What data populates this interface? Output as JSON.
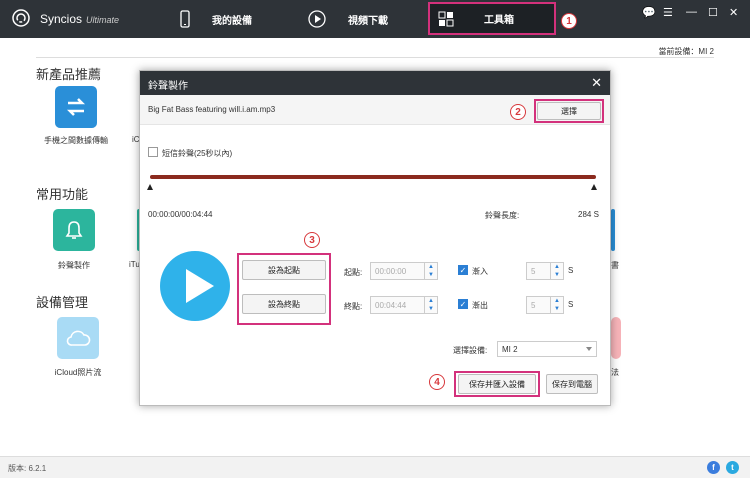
{
  "app": {
    "name": "Syncios",
    "edition": "Ultimate"
  },
  "nav": {
    "device": "我的設備",
    "video": "視頻下載",
    "toolbox": "工具箱"
  },
  "window_controls": [
    "💬",
    "☰",
    "—",
    "☐",
    "✕"
  ],
  "current_device": "當前設備：MI 2",
  "sections": {
    "new_products": {
      "title": "新產品推薦",
      "items": [
        {
          "label": "手機之間數據傳輸"
        },
        {
          "label": "iC"
        }
      ]
    },
    "common": {
      "title": "常用功能",
      "items": [
        {
          "label": "鈴聲製作"
        },
        {
          "label": "iTu"
        },
        {
          "label": "書"
        }
      ]
    },
    "device_mgmt": {
      "title": "設備管理",
      "items": [
        {
          "label": "iCloud照片流"
        },
        {
          "label": "法"
        }
      ]
    }
  },
  "modal": {
    "title": "鈴聲製作",
    "close": "✕",
    "file_name": "Big Fat Bass featuring will.i.am.mp3",
    "choose_button": "選擇",
    "sms_ringtone_label": "短信鈴聲(25秒以內)",
    "time_readout": "00:00:00/00:04:44",
    "ringtone_length_label": "鈴聲長度:",
    "ringtone_length_value": "284 S",
    "set_start_button": "設為起點",
    "set_end_button": "設為終點",
    "start_label": "起點:",
    "start_value": "00:00:00",
    "end_label": "終點:",
    "end_value": "00:04:44",
    "fade_in_label": "漸入",
    "fade_out_label": "漸出",
    "fade_in_value": "5",
    "fade_out_value": "5",
    "seconds_unit": "S",
    "select_device_label": "選擇設備:",
    "select_device_value": "MI 2",
    "save_import_button": "保存并匯入設備",
    "save_pc_button": "保存到電腦"
  },
  "steps": [
    "1",
    "2",
    "3",
    "4"
  ],
  "status": {
    "version": "版本: 6.2.1"
  },
  "colors": {
    "topbar": "#2e3338",
    "highlight": "#d3317c",
    "play": "#2fb2ea",
    "track": "#8b2a1e",
    "badge": "#d7383c"
  }
}
